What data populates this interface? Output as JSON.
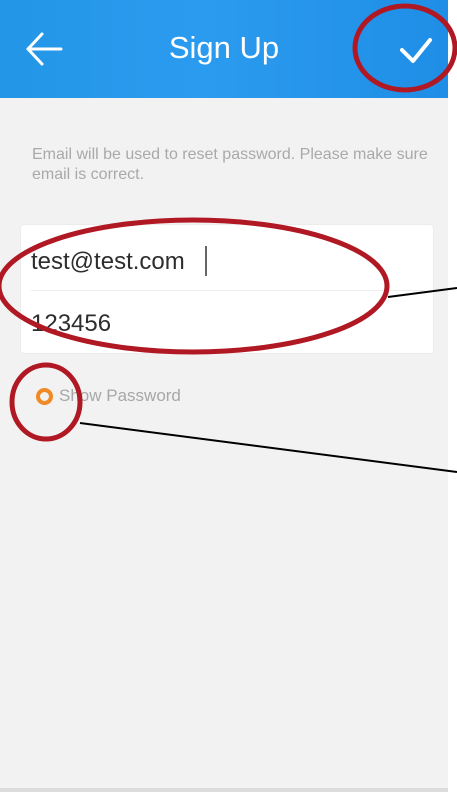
{
  "header": {
    "title": "Sign Up",
    "back_icon": "arrow-left-icon",
    "done_icon": "checkmark-icon",
    "background": "#2396e7"
  },
  "hint": {
    "text": "Email will be used to reset password. Please make sure email is correct."
  },
  "form": {
    "email": {
      "value": "test@test.com"
    },
    "password": {
      "value": "123456"
    }
  },
  "show_password": {
    "label": "Show Password",
    "checked": false,
    "radio_color": "#f08a24"
  },
  "annotations": {
    "mark_color": "#b01823"
  }
}
